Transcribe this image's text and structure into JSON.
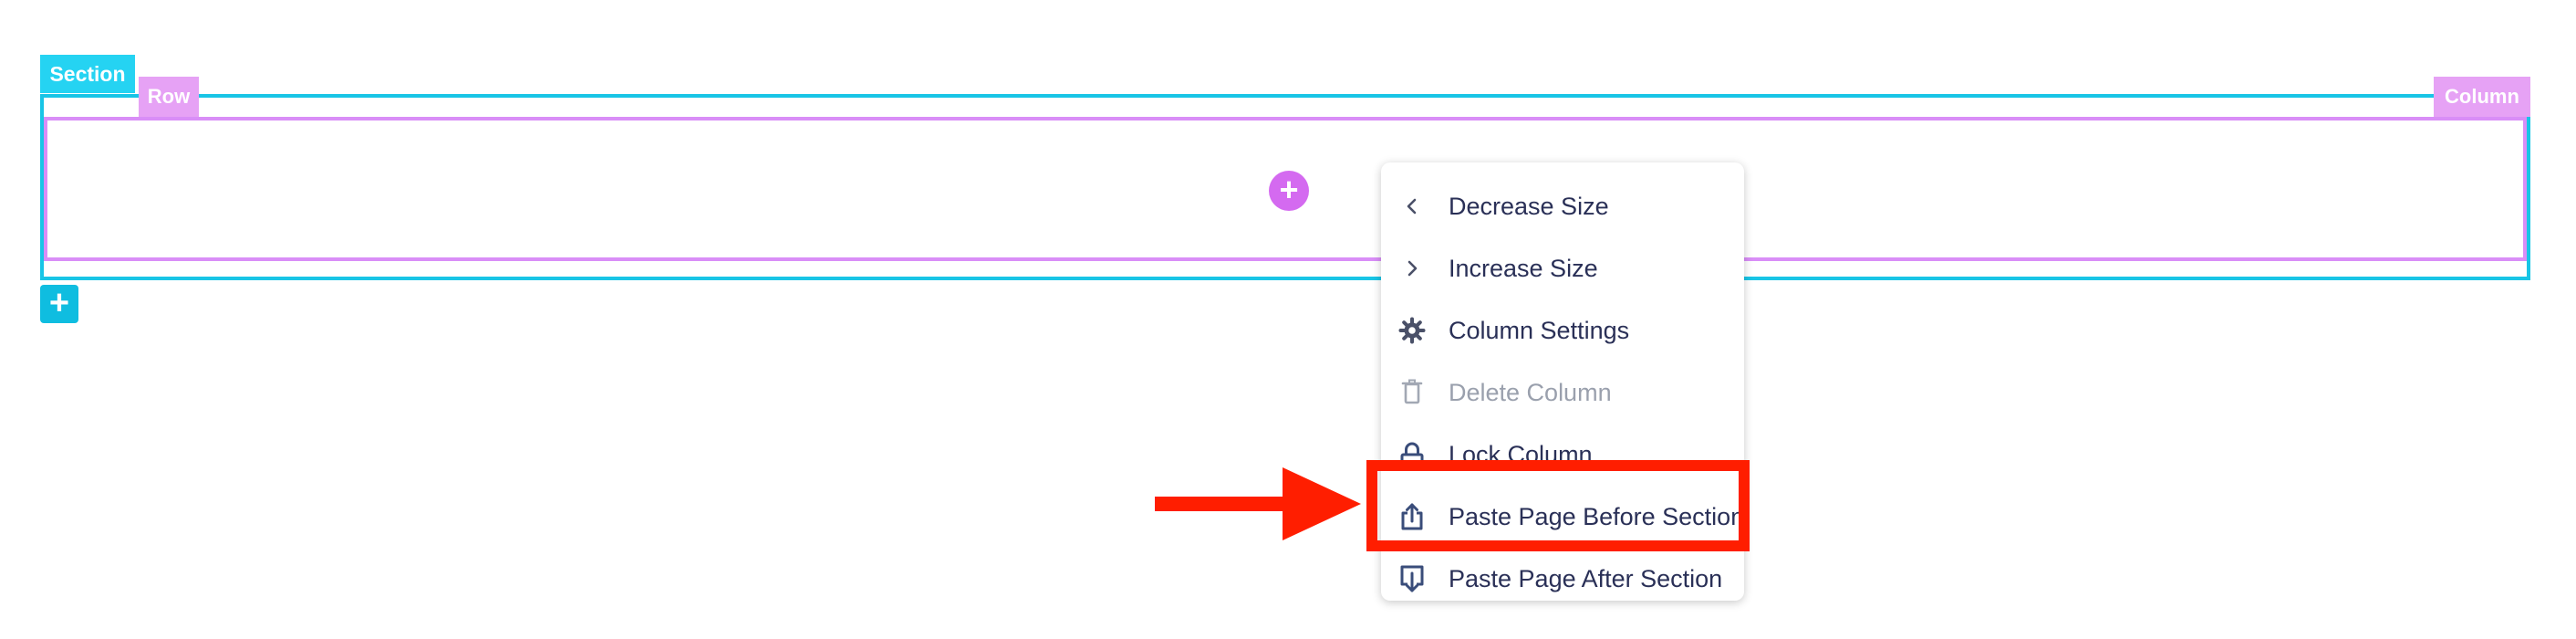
{
  "section": {
    "tag_label": "Section",
    "add_icon": "plus-icon",
    "color": "#18c5e6"
  },
  "row": {
    "tag_label": "Row",
    "color": "#d98ef7"
  },
  "column": {
    "tag_label": "Column",
    "add_icon": "plus-icon"
  },
  "context_menu": {
    "items": [
      {
        "label": "Decrease Size",
        "icon": "chevron-left-icon",
        "enabled": true
      },
      {
        "label": "Increase Size",
        "icon": "chevron-right-icon",
        "enabled": true
      },
      {
        "label": "Column Settings",
        "icon": "gear-icon",
        "enabled": true
      },
      {
        "label": "Delete Column",
        "icon": "trash-icon",
        "enabled": false
      },
      {
        "label": "Lock Column",
        "icon": "lock-icon",
        "enabled": true
      },
      {
        "label": "Paste Page Before Section",
        "icon": "paste-before-icon",
        "enabled": true,
        "highlighted": true
      },
      {
        "label": "Paste Page After Section",
        "icon": "paste-after-icon",
        "enabled": true
      }
    ]
  },
  "annotation": {
    "color": "#ff1e00"
  }
}
